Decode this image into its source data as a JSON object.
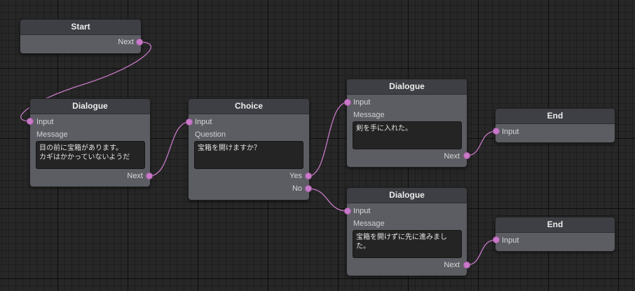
{
  "theme": {
    "wire_color": "#c879c8",
    "port_color": "#c879c8"
  },
  "nodes": {
    "start": {
      "title": "Start",
      "next_label": "Next"
    },
    "dialogue1": {
      "title": "Dialogue",
      "input_label": "Input",
      "message_label": "Message",
      "message": "目の前に宝箱があります。\nカギはかかっていないようだ",
      "next_label": "Next"
    },
    "choice": {
      "title": "Choice",
      "input_label": "Input",
      "question_label": "Question",
      "question": "宝箱を開けますか？",
      "yes_label": "Yes",
      "no_label": "No"
    },
    "dialogue2": {
      "title": "Dialogue",
      "input_label": "Input",
      "message_label": "Message",
      "message": "剣を手に入れた。",
      "next_label": "Next"
    },
    "dialogue3": {
      "title": "Dialogue",
      "input_label": "Input",
      "message_label": "Message",
      "message": "宝箱を開けずに先に進みました。",
      "next_label": "Next"
    },
    "end1": {
      "title": "End",
      "input_label": "Input"
    },
    "end2": {
      "title": "End",
      "input_label": "Input"
    }
  }
}
